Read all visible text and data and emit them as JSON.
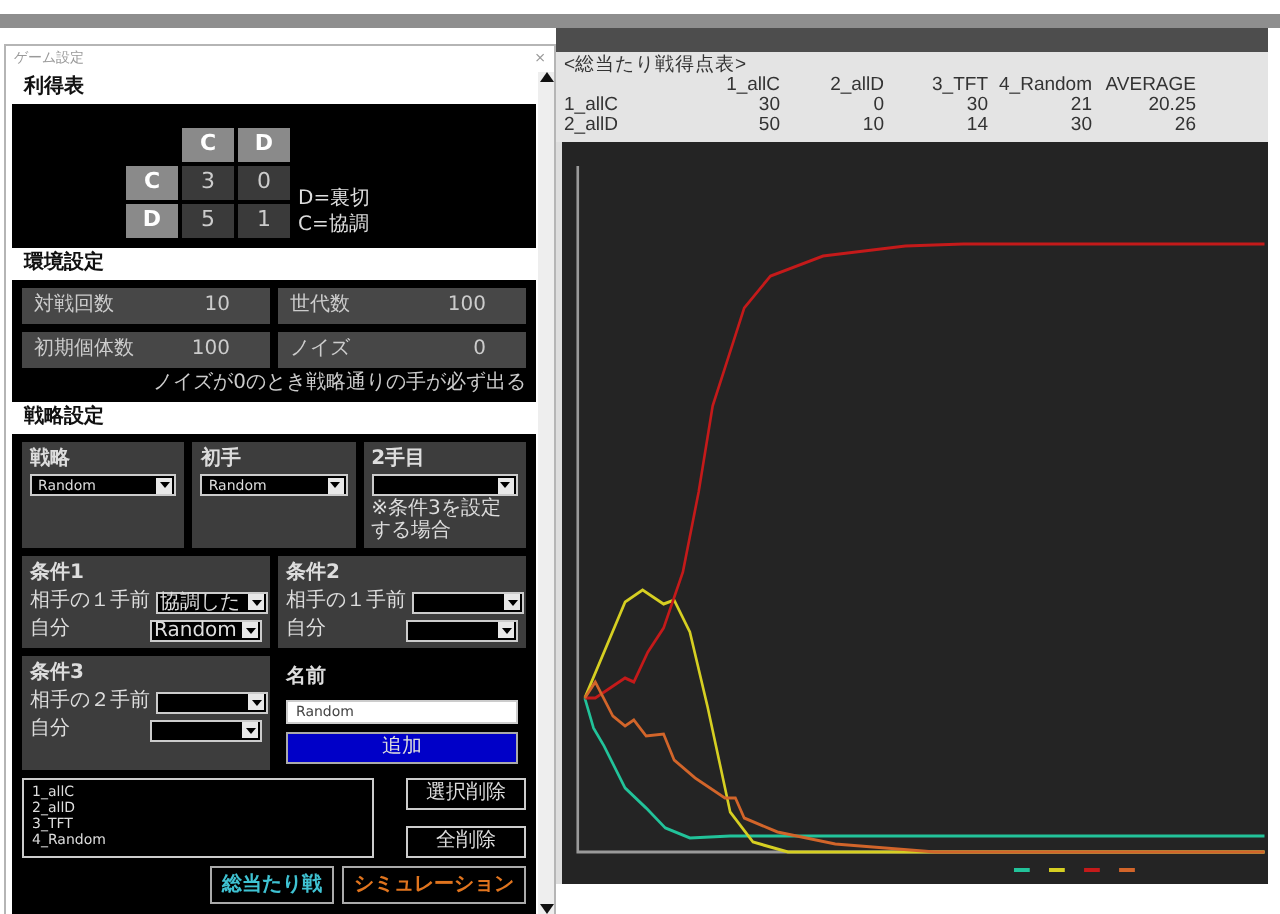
{
  "score_table": {
    "title": "<総当たり戦得点表>",
    "columns": [
      "1_allC",
      "2_allD",
      "3_TFT",
      "4_Random",
      "AVERAGE"
    ],
    "rows": [
      {
        "label": "1_allC",
        "values": [
          "30",
          "0",
          "30",
          "21",
          "20.25"
        ]
      },
      {
        "label": "2_allD",
        "values": [
          "50",
          "10",
          "14",
          "30",
          "26"
        ]
      }
    ]
  },
  "chart": {
    "series": [
      {
        "color": "#22c39a"
      },
      {
        "color": "#d6cf22"
      },
      {
        "color": "#c41a1a"
      },
      {
        "color": "#d2652a"
      }
    ]
  },
  "dialog": {
    "title": "ゲーム設定",
    "close": "×",
    "payoff": {
      "heading": "利得表",
      "col_headers": [
        "C",
        "D"
      ],
      "rows": [
        {
          "header": "C",
          "values": [
            "3",
            "0"
          ]
        },
        {
          "header": "D",
          "values": [
            "5",
            "1"
          ]
        }
      ],
      "legend": [
        "D=裏切",
        "C=協調"
      ]
    },
    "environment": {
      "heading": "環境設定",
      "fields": [
        {
          "label": "対戦回数",
          "value": "10"
        },
        {
          "label": "世代数",
          "value": "100"
        },
        {
          "label": "初期個体数",
          "value": "100"
        },
        {
          "label": "ノイズ",
          "value": "0"
        }
      ],
      "note": "ノイズが0のとき戦略通りの手が必ず出る"
    },
    "strategy": {
      "heading": "戦略設定",
      "selectors": [
        {
          "label": "戦略",
          "value": "Random"
        },
        {
          "label": "初手",
          "value": "Random"
        },
        {
          "label": "2手目",
          "note": "※条件3を設定する場合"
        }
      ],
      "conditions": [
        {
          "label": "条件1",
          "rows": [
            {
              "label": "相手の１手前",
              "value": "協調した"
            },
            {
              "label": "自分",
              "value": "Random"
            }
          ]
        },
        {
          "label": "条件2",
          "rows": [
            {
              "label": "相手の１手前"
            },
            {
              "label": "自分"
            }
          ]
        },
        {
          "label": "条件3",
          "rows": [
            {
              "label": "相手の２手前"
            },
            {
              "label": "自分"
            }
          ]
        }
      ],
      "name": {
        "label": "名前",
        "value": "Random"
      },
      "add_button": "追加",
      "list_items": [
        "1_allC",
        "2_allD",
        "3_TFT",
        "4_Random"
      ],
      "delete_buttons": [
        "選択削除",
        "全削除"
      ],
      "run_buttons": [
        {
          "label": "総当たり戦",
          "color": "#3fc3d3"
        },
        {
          "label": "シミュレーション",
          "color": "#e0741e"
        }
      ]
    }
  }
}
